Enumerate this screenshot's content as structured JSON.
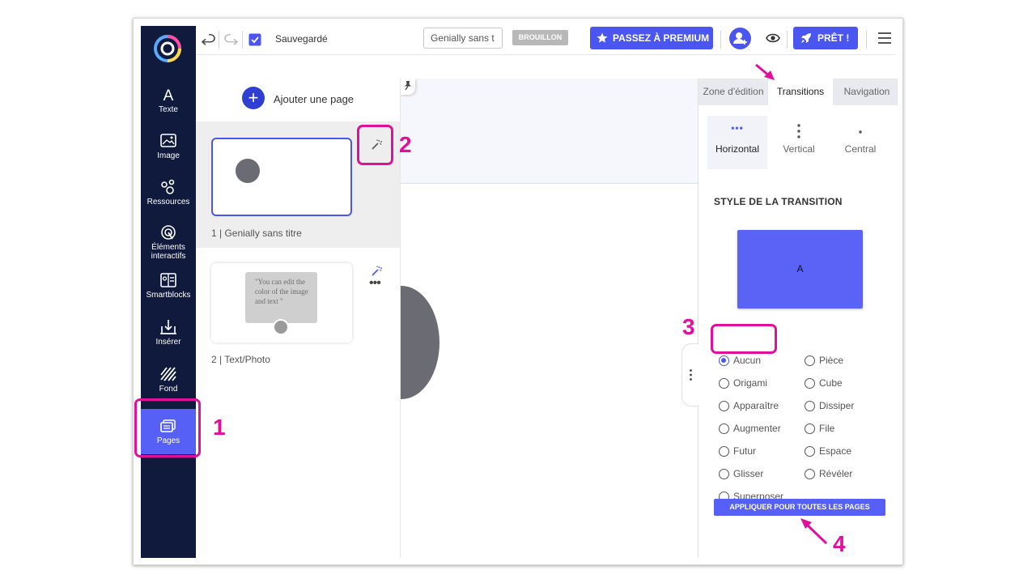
{
  "topbar": {
    "saved_label": "Sauvegardé",
    "title_value": "Genially sans t",
    "draft_badge": "BROUILLON",
    "premium_label": "PASSEZ À PREMIUM",
    "ready_label": "PRÊT !"
  },
  "sidebar": {
    "items": [
      {
        "label": "Texte",
        "icon": "text-icon"
      },
      {
        "label": "Image",
        "icon": "image-icon"
      },
      {
        "label": "Ressources",
        "icon": "resources-icon"
      },
      {
        "label": "Éléments interactifs",
        "icon": "interactive-icon"
      },
      {
        "label": "Smartblocks",
        "icon": "smartblocks-icon"
      },
      {
        "label": "Insérer",
        "icon": "insert-icon"
      },
      {
        "label": "Fond",
        "icon": "background-icon"
      },
      {
        "label": "Pages",
        "icon": "pages-icon"
      }
    ],
    "active": "Pages"
  },
  "pages_panel": {
    "add_page_label": "Ajouter une page",
    "pages": [
      {
        "label": "1 |  Genially sans titre"
      },
      {
        "label": "2 |  Text/Photo",
        "bubble_text": "\"You can edit the color of the image and text \""
      }
    ]
  },
  "right_panel": {
    "tabs": [
      "Zone d'édition",
      "Transitions",
      "Navigation"
    ],
    "active_tab": "Transitions",
    "directions": [
      "Horizontal",
      "Vertical",
      "Central"
    ],
    "active_direction": "Horizontal",
    "section_title": "STYLE DE LA TRANSITION",
    "preview_letter": "A",
    "styles_left": [
      "Aucun",
      "Origami",
      "Apparaître",
      "Augmenter",
      "Futur",
      "Glisser",
      "Superposer"
    ],
    "styles_right": [
      "Pièce",
      "Cube",
      "Dissiper",
      "File",
      "Espace",
      "Révéler"
    ],
    "selected_style": "Aucun",
    "apply_all_label": "APPLIQUER POUR TOUTES LES PAGES"
  },
  "annotations": [
    "1",
    "2",
    "3",
    "4"
  ],
  "colors": {
    "accent": "#4b56f0",
    "nav_bg": "#0f1a3c",
    "annotation": "#e0109c"
  }
}
